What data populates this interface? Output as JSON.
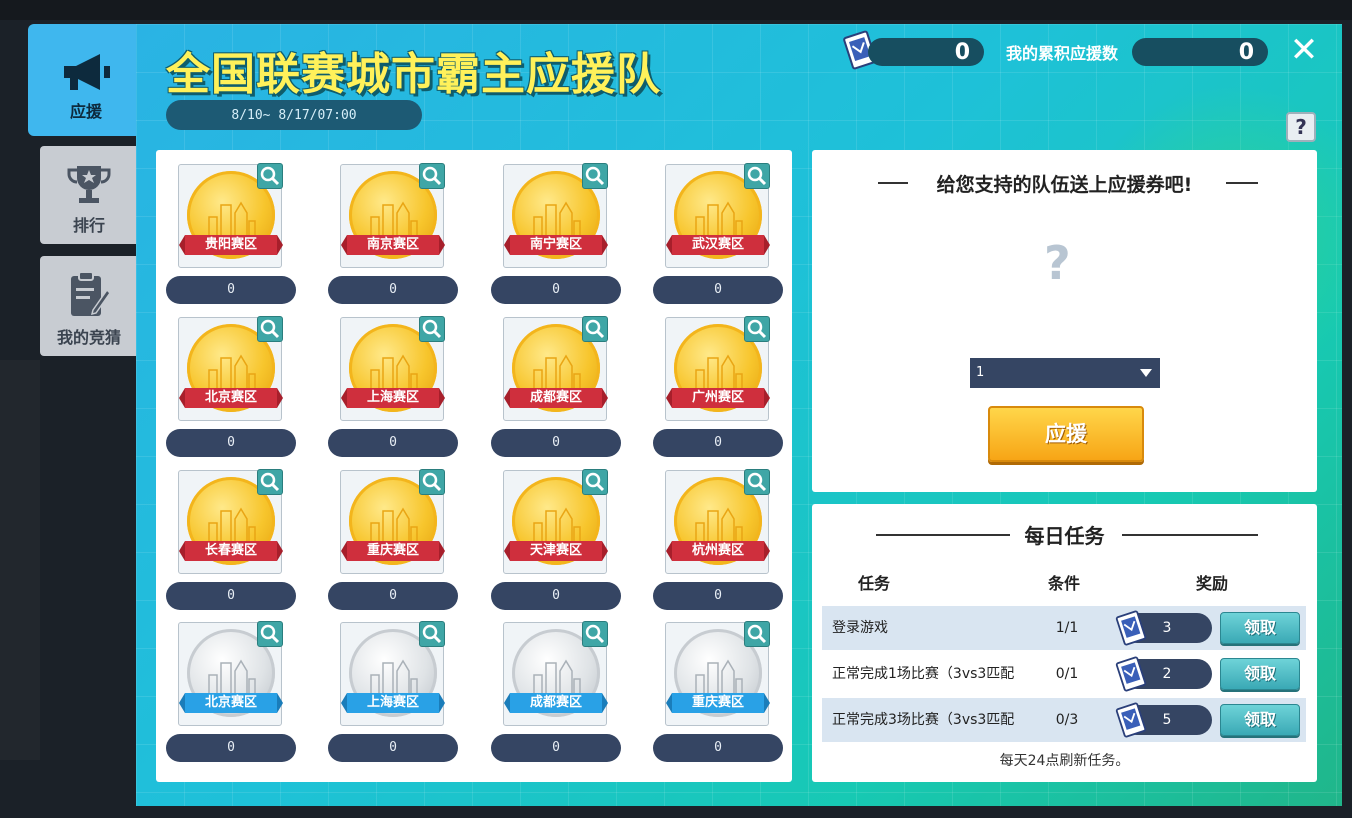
{
  "sidebar": {
    "tabs": [
      {
        "label": "应援",
        "icon": "megaphone-icon",
        "active": true
      },
      {
        "label": "排行",
        "icon": "trophy-icon",
        "active": false
      },
      {
        "label": "我的竞猜",
        "icon": "clipboard-icon",
        "active": false
      }
    ]
  },
  "header": {
    "title": "全国联赛城市霸主应援队",
    "date_range": "8/10~ 8/17/07:00",
    "ticket_count": "0",
    "cumulative_label": "我的累积应援数",
    "cumulative_count": "0",
    "close_symbol": "✕",
    "help_symbol": "?"
  },
  "medals": [
    {
      "city": "贵阳赛区",
      "count": "0",
      "tier": "gold"
    },
    {
      "city": "南京赛区",
      "count": "0",
      "tier": "gold"
    },
    {
      "city": "南宁赛区",
      "count": "0",
      "tier": "gold"
    },
    {
      "city": "武汉赛区",
      "count": "0",
      "tier": "gold"
    },
    {
      "city": "北京赛区",
      "count": "0",
      "tier": "gold"
    },
    {
      "city": "上海赛区",
      "count": "0",
      "tier": "gold"
    },
    {
      "city": "成都赛区",
      "count": "0",
      "tier": "gold"
    },
    {
      "city": "广州赛区",
      "count": "0",
      "tier": "gold"
    },
    {
      "city": "长春赛区",
      "count": "0",
      "tier": "gold"
    },
    {
      "city": "重庆赛区",
      "count": "0",
      "tier": "gold"
    },
    {
      "city": "天津赛区",
      "count": "0",
      "tier": "gold"
    },
    {
      "city": "杭州赛区",
      "count": "0",
      "tier": "gold"
    },
    {
      "city": "北京赛区",
      "count": "0",
      "tier": "silver"
    },
    {
      "city": "上海赛区",
      "count": "0",
      "tier": "silver"
    },
    {
      "city": "成都赛区",
      "count": "0",
      "tier": "silver"
    },
    {
      "city": "重庆赛区",
      "count": "0",
      "tier": "silver"
    }
  ],
  "support": {
    "title": "给您支持的队伍送上应援券吧!",
    "question_mark": "?",
    "select_value": "1",
    "button_label": "应援"
  },
  "tasks": {
    "title": "每日任务",
    "headers": {
      "task": "任务",
      "condition": "条件",
      "reward": "奖励"
    },
    "rows": [
      {
        "name": "登录游戏",
        "condition": "1/1",
        "reward": "3",
        "claim": "领取"
      },
      {
        "name": "正常完成1场比赛（3vs3匹配",
        "condition": "0/1",
        "reward": "2",
        "claim": "领取"
      },
      {
        "name": "正常完成3场比赛（3vs3匹配",
        "condition": "0/3",
        "reward": "5",
        "claim": "领取"
      }
    ],
    "note": "每天24点刷新任务。"
  },
  "colors": {
    "panel_accent": "#2ab3e4",
    "title_yellow": "#fff15a",
    "ribbon_red": "#cf2f3d",
    "ribbon_blue": "#29a1e6",
    "pill_navy": "#354563",
    "button_orange": "#f7a516",
    "button_teal": "#3aa9b5"
  }
}
